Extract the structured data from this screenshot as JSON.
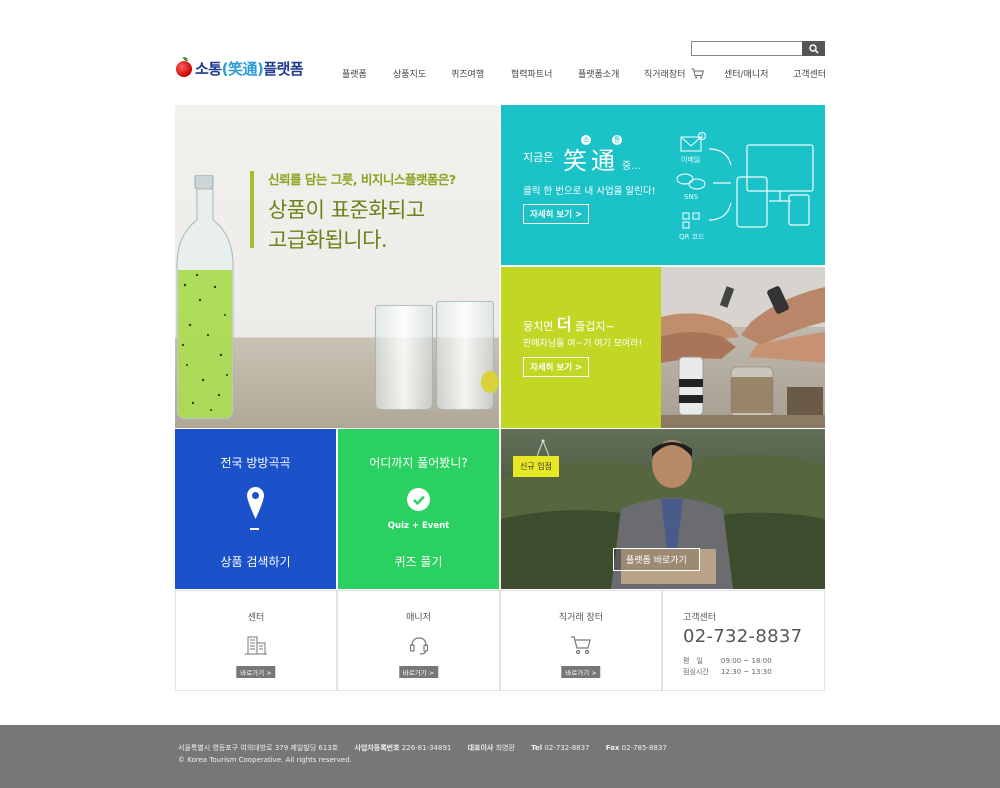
{
  "header": {
    "logo": {
      "main": "소통",
      "hanja": "(笑通)",
      "suffix": "플랫폼"
    },
    "search": {
      "placeholder": "",
      "icon": "search-icon"
    },
    "nav": [
      {
        "label": "플랫폼"
      },
      {
        "label": "상품지도"
      },
      {
        "label": "퀴즈여행"
      },
      {
        "label": "협력파트너"
      },
      {
        "label": "플랫폼소개"
      },
      {
        "label": "직거래장터",
        "icon": "cart-icon"
      },
      {
        "label": "센터/매니저"
      },
      {
        "label": "고객센터"
      }
    ]
  },
  "hero": {
    "subtitle_prefix": "신뢰를 담는 그릇, ",
    "subtitle_bold": "비지니스플랫폼은?",
    "title_line1": "상품이 표준화되고",
    "title_line2": "고급화됩니다."
  },
  "teal_panel": {
    "lead": "지금은",
    "hanja": "笑通",
    "dot1": "소",
    "dot2": "통",
    "trail": "중…",
    "desc": "클릭 한 번으로 내 사업을 알린다!",
    "button": "자세히 보기 >",
    "icons": [
      {
        "label": "이메일",
        "icon": "email-icon",
        "badge": "1"
      },
      {
        "label": "SNS",
        "icon": "sns-icon"
      },
      {
        "label": "QR 코드",
        "icon": "qr-icon"
      }
    ]
  },
  "lime_panel": {
    "title_prefix": "뭉치면 ",
    "title_big": "더",
    "title_suffix": " 즐겁지~",
    "desc": "판매자님들 여~기 여기 모여라!",
    "button": "자세히 보기 >"
  },
  "blue_box": {
    "title": "전국 방방곡곡",
    "bottom": "상품 검색하기",
    "icon": "map-pin-icon"
  },
  "green_box": {
    "title": "어디까지 풀어봤니?",
    "label": "Quiz + Event",
    "bottom": "퀴즈 풀기",
    "icon": "check-icon"
  },
  "photo_panel": {
    "tag": "신규 입점",
    "button": "플랫폼 바로가기"
  },
  "cells": [
    {
      "title": "센터",
      "button": "바로가기 >",
      "icon": "building-icon"
    },
    {
      "title": "매니저",
      "button": "바로가기 >",
      "icon": "headset-icon"
    },
    {
      "title": "직거래 장터",
      "button": "바로가기 >",
      "icon": "cart-icon"
    }
  ],
  "customer_service": {
    "label": "고객센터",
    "phone": "02-732-8837",
    "hours": [
      {
        "key": "평　일",
        "value": "09:00 ~ 18:00"
      },
      {
        "key": "점심시간",
        "value": "12:30 ~ 13:30"
      }
    ]
  },
  "footer": {
    "address": "서울특별시 영등포구 여의대방로 379 제일빌딩 613호",
    "biz_label": "사업자등록번호",
    "biz_value": "226-81-34891",
    "ceo_label": "대표이사",
    "ceo_value": "최영환",
    "tel_label": "Tel",
    "tel_value": "02-732-8837",
    "fax_label": "Fax",
    "fax_value": "02-785-8837",
    "copyright": "© Korea Tourism Cooperative. All rights reserved."
  },
  "colors": {
    "teal": "#1bc3c8",
    "lime": "#c2d725",
    "blue": "#1b52c9",
    "green": "#2ad060",
    "hero_green": "#8aa21c",
    "footer_bg": "#777777"
  }
}
